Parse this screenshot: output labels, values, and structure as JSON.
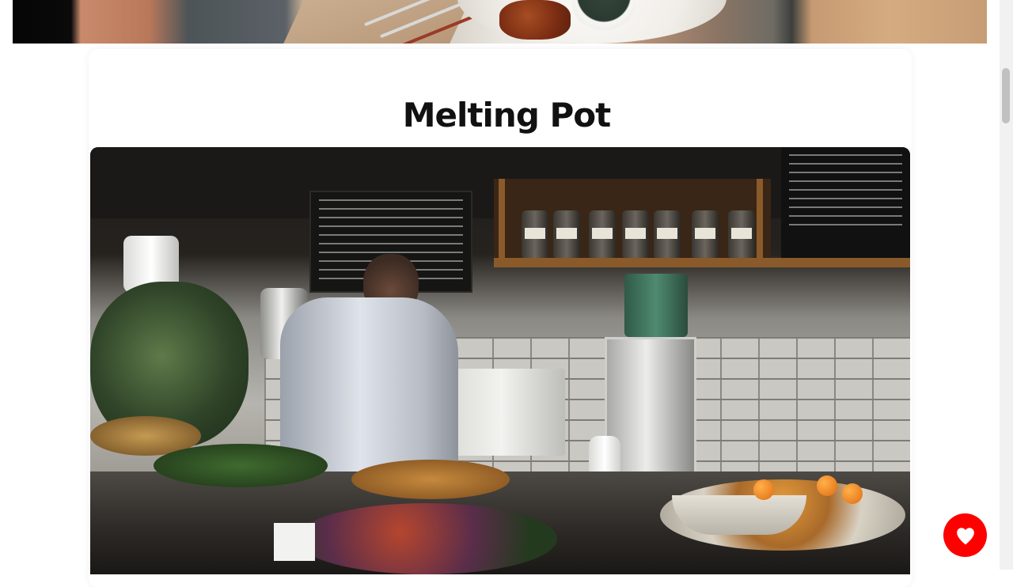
{
  "page": {
    "background": "#ffffff"
  },
  "card": {
    "title": "Melting Pot"
  },
  "favorite_button": {
    "icon": "heart-icon",
    "color": "#ff0000"
  }
}
